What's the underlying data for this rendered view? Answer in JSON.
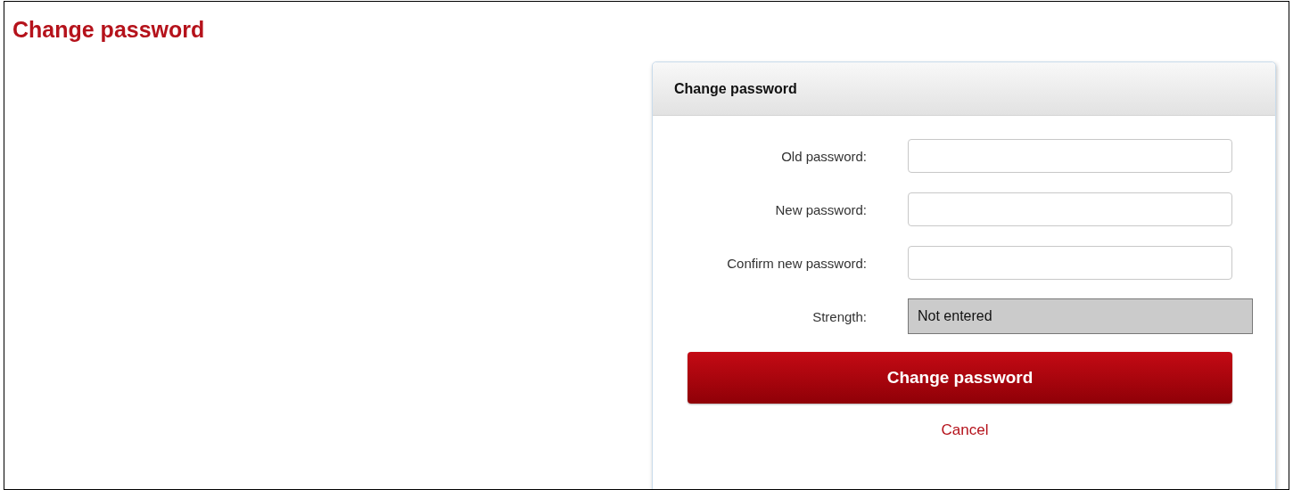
{
  "page_title": "Change password",
  "panel": {
    "title": "Change password",
    "fields": [
      {
        "label": "Old password:"
      },
      {
        "label": "New password:"
      },
      {
        "label": "Confirm new password:"
      }
    ],
    "strength": {
      "label": "Strength:",
      "value": "Not entered"
    },
    "submit_button": "Change password",
    "cancel_link": "Cancel"
  }
}
